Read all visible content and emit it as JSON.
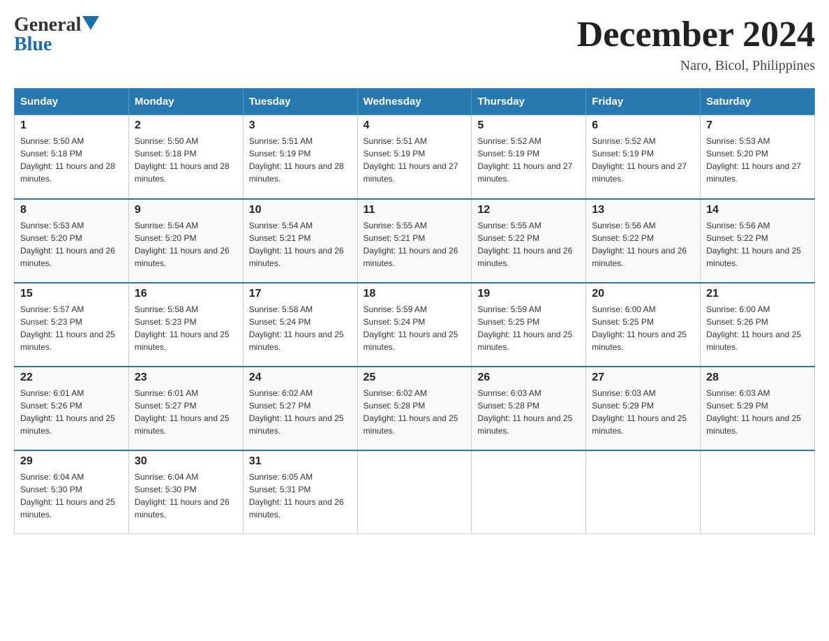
{
  "logo": {
    "general": "General",
    "blue": "Blue",
    "line2": "Blue"
  },
  "title": "December 2024",
  "subtitle": "Naro, Bicol, Philippines",
  "days_of_week": [
    "Sunday",
    "Monday",
    "Tuesday",
    "Wednesday",
    "Thursday",
    "Friday",
    "Saturday"
  ],
  "weeks": [
    [
      {
        "day": "1",
        "sunrise": "5:50 AM",
        "sunset": "5:18 PM",
        "daylight": "11 hours and 28 minutes."
      },
      {
        "day": "2",
        "sunrise": "5:50 AM",
        "sunset": "5:18 PM",
        "daylight": "11 hours and 28 minutes."
      },
      {
        "day": "3",
        "sunrise": "5:51 AM",
        "sunset": "5:19 PM",
        "daylight": "11 hours and 28 minutes."
      },
      {
        "day": "4",
        "sunrise": "5:51 AM",
        "sunset": "5:19 PM",
        "daylight": "11 hours and 27 minutes."
      },
      {
        "day": "5",
        "sunrise": "5:52 AM",
        "sunset": "5:19 PM",
        "daylight": "11 hours and 27 minutes."
      },
      {
        "day": "6",
        "sunrise": "5:52 AM",
        "sunset": "5:19 PM",
        "daylight": "11 hours and 27 minutes."
      },
      {
        "day": "7",
        "sunrise": "5:53 AM",
        "sunset": "5:20 PM",
        "daylight": "11 hours and 27 minutes."
      }
    ],
    [
      {
        "day": "8",
        "sunrise": "5:53 AM",
        "sunset": "5:20 PM",
        "daylight": "11 hours and 26 minutes."
      },
      {
        "day": "9",
        "sunrise": "5:54 AM",
        "sunset": "5:20 PM",
        "daylight": "11 hours and 26 minutes."
      },
      {
        "day": "10",
        "sunrise": "5:54 AM",
        "sunset": "5:21 PM",
        "daylight": "11 hours and 26 minutes."
      },
      {
        "day": "11",
        "sunrise": "5:55 AM",
        "sunset": "5:21 PM",
        "daylight": "11 hours and 26 minutes."
      },
      {
        "day": "12",
        "sunrise": "5:55 AM",
        "sunset": "5:22 PM",
        "daylight": "11 hours and 26 minutes."
      },
      {
        "day": "13",
        "sunrise": "5:56 AM",
        "sunset": "5:22 PM",
        "daylight": "11 hours and 26 minutes."
      },
      {
        "day": "14",
        "sunrise": "5:56 AM",
        "sunset": "5:22 PM",
        "daylight": "11 hours and 25 minutes."
      }
    ],
    [
      {
        "day": "15",
        "sunrise": "5:57 AM",
        "sunset": "5:23 PM",
        "daylight": "11 hours and 25 minutes."
      },
      {
        "day": "16",
        "sunrise": "5:58 AM",
        "sunset": "5:23 PM",
        "daylight": "11 hours and 25 minutes."
      },
      {
        "day": "17",
        "sunrise": "5:58 AM",
        "sunset": "5:24 PM",
        "daylight": "11 hours and 25 minutes."
      },
      {
        "day": "18",
        "sunrise": "5:59 AM",
        "sunset": "5:24 PM",
        "daylight": "11 hours and 25 minutes."
      },
      {
        "day": "19",
        "sunrise": "5:59 AM",
        "sunset": "5:25 PM",
        "daylight": "11 hours and 25 minutes."
      },
      {
        "day": "20",
        "sunrise": "6:00 AM",
        "sunset": "5:25 PM",
        "daylight": "11 hours and 25 minutes."
      },
      {
        "day": "21",
        "sunrise": "6:00 AM",
        "sunset": "5:26 PM",
        "daylight": "11 hours and 25 minutes."
      }
    ],
    [
      {
        "day": "22",
        "sunrise": "6:01 AM",
        "sunset": "5:26 PM",
        "daylight": "11 hours and 25 minutes."
      },
      {
        "day": "23",
        "sunrise": "6:01 AM",
        "sunset": "5:27 PM",
        "daylight": "11 hours and 25 minutes."
      },
      {
        "day": "24",
        "sunrise": "6:02 AM",
        "sunset": "5:27 PM",
        "daylight": "11 hours and 25 minutes."
      },
      {
        "day": "25",
        "sunrise": "6:02 AM",
        "sunset": "5:28 PM",
        "daylight": "11 hours and 25 minutes."
      },
      {
        "day": "26",
        "sunrise": "6:03 AM",
        "sunset": "5:28 PM",
        "daylight": "11 hours and 25 minutes."
      },
      {
        "day": "27",
        "sunrise": "6:03 AM",
        "sunset": "5:29 PM",
        "daylight": "11 hours and 25 minutes."
      },
      {
        "day": "28",
        "sunrise": "6:03 AM",
        "sunset": "5:29 PM",
        "daylight": "11 hours and 25 minutes."
      }
    ],
    [
      {
        "day": "29",
        "sunrise": "6:04 AM",
        "sunset": "5:30 PM",
        "daylight": "11 hours and 25 minutes."
      },
      {
        "day": "30",
        "sunrise": "6:04 AM",
        "sunset": "5:30 PM",
        "daylight": "11 hours and 26 minutes."
      },
      {
        "day": "31",
        "sunrise": "6:05 AM",
        "sunset": "5:31 PM",
        "daylight": "11 hours and 26 minutes."
      },
      null,
      null,
      null,
      null
    ]
  ]
}
